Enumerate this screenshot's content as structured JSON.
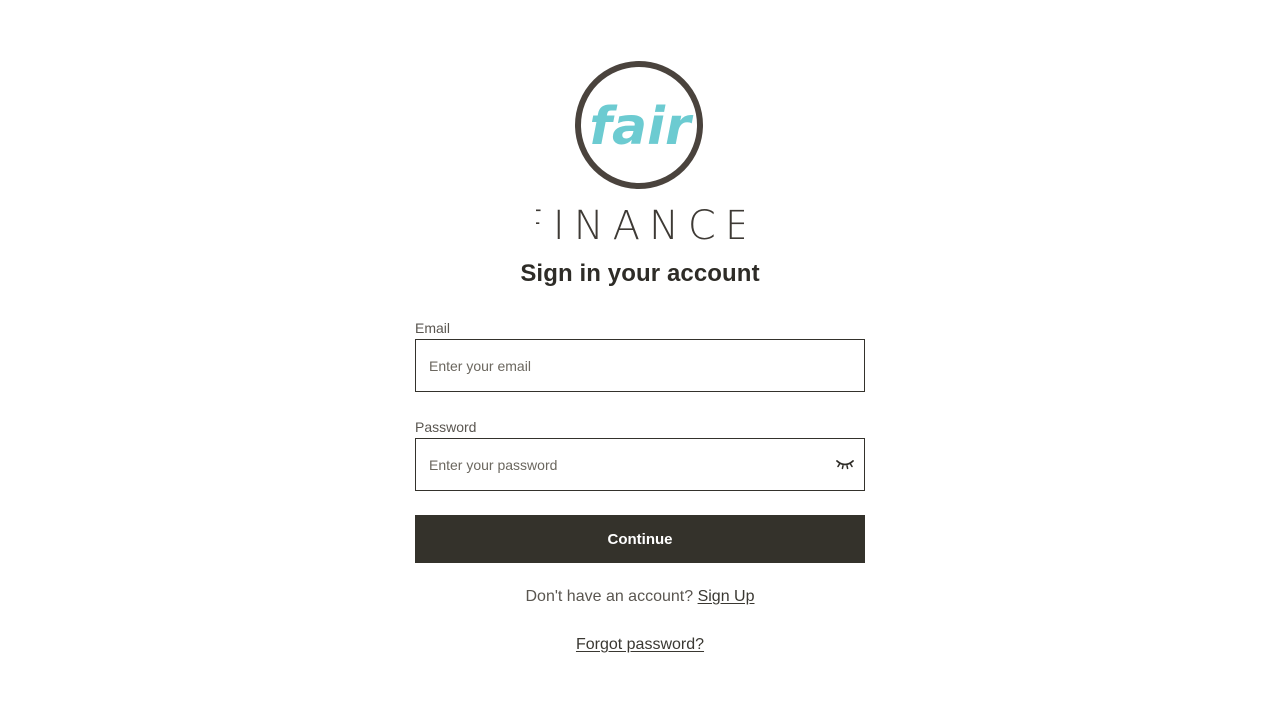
{
  "brand": {
    "logo_word": "fair",
    "logo_subtitle": "FINANCE",
    "logo_word_color": "#6ccbd1",
    "logo_ring_color": "#4a433d",
    "logo_subtitle_color": "#3e3a35"
  },
  "heading": "Sign in your account",
  "form": {
    "email_label": "Email",
    "email_placeholder": "Enter your email",
    "email_value": "",
    "password_label": "Password",
    "password_placeholder": "Enter your password",
    "password_value": "",
    "password_toggle_icon": "eye-closed-icon",
    "continue_label": "Continue"
  },
  "footer": {
    "signup_prompt": "Don't have an account?",
    "signup_link": "Sign Up",
    "forgot_link": "Forgot password?"
  },
  "colors": {
    "primary_button": "#34322b",
    "text": "#2e2c27",
    "muted_text": "#5a5650"
  }
}
